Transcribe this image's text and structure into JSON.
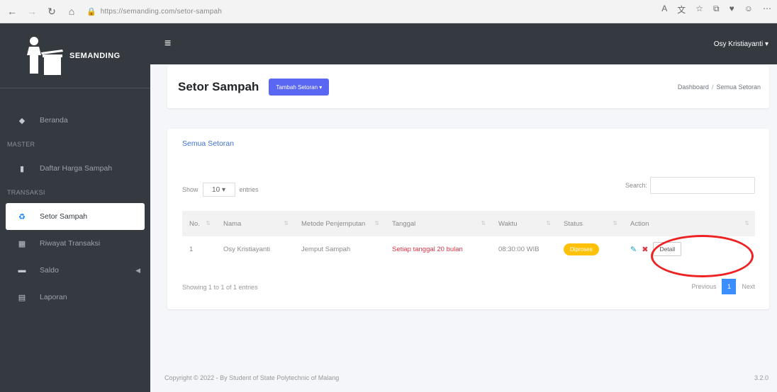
{
  "browser": {
    "url": "https://semanding.com/setor-sampah",
    "lock_icon": "lock-icon"
  },
  "sidebar": {
    "brand": "SEMANDING",
    "items": [
      {
        "icon": "dashboard-icon",
        "label": "Beranda"
      },
      {
        "header": "MASTER"
      },
      {
        "icon": "trash-icon",
        "label": "Daftar Harga Sampah"
      },
      {
        "header": "TRANSAKSI"
      },
      {
        "icon": "recycle-icon",
        "label": "Setor Sampah"
      },
      {
        "icon": "calculator-icon",
        "label": "Riwayat Transaksi"
      },
      {
        "icon": "list-icon",
        "label": "Saldo"
      },
      {
        "icon": "report-icon",
        "label": "Laporan"
      }
    ]
  },
  "topnav": {
    "user": "Osy Kristiayanti ▾"
  },
  "header": {
    "title": "Setor Sampah",
    "add_button": "Tambah Setoran ▾",
    "breadcrumb_home": "Dashboard",
    "breadcrumb_sep": "/",
    "breadcrumb_current": "Semua Setoran"
  },
  "card": {
    "title": "Semua Setoran",
    "show_label": "Show",
    "entries_value": "10 ▾",
    "entries_label": "entries",
    "search_label": "Search:",
    "columns": [
      "No.",
      "Nama",
      "Metode Penjemputan",
      "Tanggal",
      "Waktu",
      "Status",
      "Action"
    ],
    "rows": [
      {
        "no": "1",
        "nama": "Osy Kristiayanti",
        "metode": "Jemput Sampah",
        "tanggal": "Setiap tanggal 20 bulan",
        "waktu": "08:30:00 WIB",
        "status": "Diproses",
        "detail": "Detail"
      }
    ],
    "showing": "Showing 1 to 1 of 1 entries",
    "prev": "Previous",
    "page": "1",
    "next": "Next"
  },
  "footer": {
    "copyright": "Copyright © 2022 - By Student of State Polytechnic of Malang",
    "version": "3.2.0"
  },
  "colors": {
    "sidebar": "#343a40",
    "accent": "#5a67f2",
    "badge": "#ffc107",
    "highlight": "#ee2222"
  }
}
